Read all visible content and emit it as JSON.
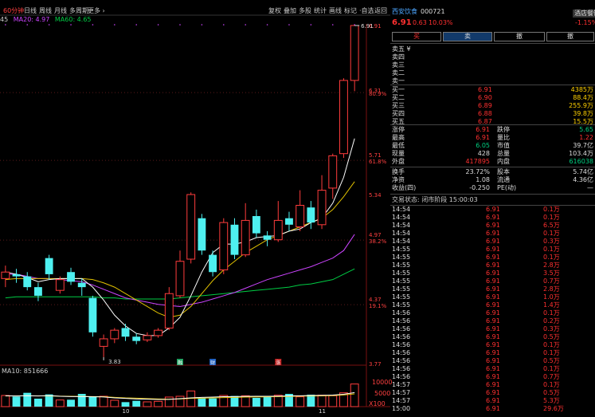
{
  "toolbar": {
    "period": "60分钟",
    "items": [
      "日线",
      "周线",
      "月线",
      "多周期",
      "更多 ›"
    ],
    "right_items": [
      "复权",
      "叠加",
      "多股",
      "统计",
      "画线",
      "标记",
      "·自选",
      "返回"
    ]
  },
  "ma_legend": {
    "prefix": "45",
    "ma20_label": "MA20: 4.97",
    "ma60_label": "MA60: 4.65",
    "ma20_color": "#cc44ff",
    "ma60_color": "#00cc44"
  },
  "price_axis": [
    {
      "label": "6.91",
      "price": 6.91
    },
    {
      "label": "6.31",
      "price": 6.31
    },
    {
      "label": "80.9%",
      "price": 6.28
    },
    {
      "label": "5.71",
      "price": 5.71
    },
    {
      "label": "61.8%",
      "price": 5.65
    },
    {
      "label": "5.34",
      "price": 5.34
    },
    {
      "label": "4.97",
      "price": 4.97
    },
    {
      "label": "38.2%",
      "price": 4.91
    },
    {
      "label": "4.37",
      "price": 4.37
    },
    {
      "label": "19.1%",
      "price": 4.31
    },
    {
      "label": "3.77",
      "price": 3.77
    }
  ],
  "chart_data": {
    "type": "candlestick",
    "annotations": {
      "high_label": "6.91",
      "low_label": "3.83"
    },
    "price_range": [
      3.77,
      6.91
    ],
    "x_tick_labels": [
      "10",
      "11"
    ],
    "event_markers": [
      "融",
      "财",
      "涨"
    ],
    "candles": [
      {
        "o": 4.56,
        "c": 4.62,
        "h": 4.68,
        "l": 4.48
      },
      {
        "o": 4.6,
        "c": 4.58,
        "h": 4.65,
        "l": 4.52
      },
      {
        "o": 4.58,
        "c": 4.48,
        "h": 4.62,
        "l": 4.45
      },
      {
        "o": 4.48,
        "c": 4.4,
        "h": 4.52,
        "l": 4.35
      },
      {
        "o": 4.75,
        "c": 4.6,
        "h": 4.78,
        "l": 4.55
      },
      {
        "o": 4.45,
        "c": 4.55,
        "h": 4.58,
        "l": 4.42
      },
      {
        "o": 4.62,
        "c": 4.53,
        "h": 4.66,
        "l": 4.5
      },
      {
        "o": 4.52,
        "c": 4.48,
        "h": 4.56,
        "l": 4.4
      },
      {
        "o": 4.38,
        "c": 4.06,
        "h": 4.4,
        "l": 4.02
      },
      {
        "o": 3.93,
        "c": 4.0,
        "h": 4.04,
        "l": 3.83
      },
      {
        "o": 4.0,
        "c": 4.08,
        "h": 4.1,
        "l": 3.96
      },
      {
        "o": 4.1,
        "c": 4.02,
        "h": 4.14,
        "l": 3.98
      },
      {
        "o": 4.02,
        "c": 3.98,
        "h": 4.05,
        "l": 3.95
      },
      {
        "o": 3.99,
        "c": 4.03,
        "h": 4.06,
        "l": 3.97
      },
      {
        "o": 4.03,
        "c": 4.08,
        "h": 4.1,
        "l": 4.01
      },
      {
        "o": 4.1,
        "c": 4.42,
        "h": 4.48,
        "l": 4.08
      },
      {
        "o": 4.4,
        "c": 4.72,
        "h": 4.82,
        "l": 4.38
      },
      {
        "o": 4.74,
        "c": 5.34,
        "h": 5.36,
        "l": 4.7
      },
      {
        "o": 5.12,
        "c": 4.82,
        "h": 5.16,
        "l": 4.78
      },
      {
        "o": 4.78,
        "c": 4.62,
        "h": 4.82,
        "l": 4.58
      },
      {
        "o": 4.64,
        "c": 5.08,
        "h": 5.12,
        "l": 4.6
      },
      {
        "o": 5.06,
        "c": 4.78,
        "h": 5.12,
        "l": 4.74
      },
      {
        "o": 4.78,
        "c": 5.1,
        "h": 5.26,
        "l": 4.76
      },
      {
        "o": 5.14,
        "c": 4.98,
        "h": 5.2,
        "l": 4.94
      },
      {
        "o": 4.96,
        "c": 4.92,
        "h": 5.0,
        "l": 4.86
      },
      {
        "o": 4.92,
        "c": 5.1,
        "h": 5.28,
        "l": 4.9
      },
      {
        "o": 5.12,
        "c": 5.06,
        "h": 5.18,
        "l": 5.0
      },
      {
        "o": 5.04,
        "c": 5.24,
        "h": 5.38,
        "l": 5.0
      },
      {
        "o": 5.22,
        "c": 5.08,
        "h": 5.28,
        "l": 5.02
      },
      {
        "o": 5.06,
        "c": 5.38,
        "h": 5.52,
        "l": 5.02
      },
      {
        "o": 5.4,
        "c": 5.7,
        "h": 5.72,
        "l": 5.3
      },
      {
        "o": 5.72,
        "c": 6.4,
        "h": 6.42,
        "l": 5.68
      },
      {
        "o": 6.4,
        "c": 6.91,
        "h": 6.91,
        "l": 6.3
      }
    ],
    "ma_white": [
      4.62,
      4.6,
      4.57,
      4.53,
      4.55,
      4.56,
      4.56,
      4.56,
      4.48,
      4.36,
      4.22,
      4.12,
      4.05,
      4.03,
      4.03,
      4.1,
      4.2,
      4.4,
      4.62,
      4.8,
      4.88,
      4.88,
      4.9,
      4.94,
      4.95,
      4.96,
      5.0,
      5.02,
      5.08,
      5.12,
      5.26,
      5.5,
      5.86
    ],
    "ma_yellow": [
      4.55,
      4.56,
      4.56,
      4.56,
      4.56,
      4.56,
      4.56,
      4.56,
      4.55,
      4.52,
      4.48,
      4.42,
      4.36,
      4.3,
      4.24,
      4.2,
      4.22,
      4.3,
      4.42,
      4.54,
      4.64,
      4.72,
      4.8,
      4.86,
      4.92,
      4.96,
      5.0,
      5.04,
      5.08,
      5.12,
      5.2,
      5.32,
      5.46
    ],
    "ma20": [
      4.6,
      4.6,
      4.58,
      4.56,
      4.56,
      4.55,
      4.54,
      4.53,
      4.5,
      4.46,
      4.42,
      4.38,
      4.36,
      4.34,
      4.32,
      4.31,
      4.3,
      4.32,
      4.34,
      4.37,
      4.4,
      4.43,
      4.47,
      4.51,
      4.55,
      4.58,
      4.61,
      4.64,
      4.67,
      4.71,
      4.75,
      4.82,
      4.97
    ],
    "ma60": [
      4.38,
      4.39,
      4.39,
      4.39,
      4.39,
      4.39,
      4.39,
      4.39,
      4.39,
      4.38,
      4.38,
      4.37,
      4.37,
      4.37,
      4.37,
      4.37,
      4.38,
      4.39,
      4.4,
      4.41,
      4.42,
      4.43,
      4.44,
      4.45,
      4.46,
      4.47,
      4.48,
      4.5,
      4.51,
      4.53,
      4.55,
      4.6,
      4.65
    ],
    "volume": [
      4200,
      3800,
      5200,
      3000,
      4600,
      2500,
      2600,
      4800,
      3600,
      3900,
      2400,
      1700,
      2200,
      1800,
      2000,
      3600,
      3900,
      5900,
      3300,
      3100,
      4200,
      4000,
      4100,
      3300,
      3600,
      4300,
      4800,
      3700,
      4500,
      4300,
      4100,
      5200,
      8516
    ],
    "volume_max": 12000,
    "vol_ma_yellow": [
      4000,
      4050,
      4100,
      4050,
      4000,
      3950,
      3900,
      3850,
      3800,
      3750,
      3500,
      3300,
      3200,
      3050,
      2900,
      2800,
      2900,
      3100,
      3200,
      3300,
      3400,
      3500,
      3600,
      3650,
      3700,
      3750,
      3850,
      3950,
      4000,
      4050,
      4150,
      4400,
      4800
    ],
    "vol_ma_white": [
      4100,
      4000,
      4100,
      4000,
      4150,
      3900,
      3800,
      3800,
      3700,
      3650,
      3300,
      3100,
      2900,
      2800,
      2700,
      2750,
      3000,
      3300,
      3500,
      3600,
      3750,
      3800,
      3850,
      3900,
      3900,
      3950,
      4050,
      4100,
      4200,
      4250,
      4350,
      4650,
      5300
    ]
  },
  "volume_panel": {
    "label": "MA10: 851666",
    "axis": [
      "10000",
      "5000",
      "X100"
    ]
  },
  "quote": {
    "name": "西安饮食",
    "code": "000721",
    "price": "6.91",
    "change": "0.63",
    "change_pct": "10.03%",
    "pct_badge": "-1.15%",
    "badge_top": "酒店餐饮",
    "buttons": [
      "买",
      "卖",
      "撤",
      "撤"
    ],
    "asks": [
      {
        "label": "卖五 ¥",
        "price": "",
        "vol": ""
      },
      {
        "label": "卖四",
        "price": "",
        "vol": ""
      },
      {
        "label": "卖三",
        "price": "",
        "vol": ""
      },
      {
        "label": "卖二",
        "price": "",
        "vol": ""
      },
      {
        "label": "卖一",
        "price": "",
        "vol": ""
      }
    ],
    "bids": [
      {
        "label": "买一",
        "price": "6.91",
        "vol": "4385万"
      },
      {
        "label": "买二",
        "price": "6.90",
        "vol": "88.4万"
      },
      {
        "label": "买三",
        "price": "6.89",
        "vol": "255.9万"
      },
      {
        "label": "买四",
        "price": "6.88",
        "vol": "39.8万"
      },
      {
        "label": "买五",
        "price": "6.87",
        "vol": "15.5万"
      }
    ],
    "stats": [
      {
        "l1": "涨停",
        "v1": "6.91",
        "c1": "r",
        "l2": "跌停",
        "v2": "5.65",
        "c2": "g"
      },
      {
        "l1": "最高",
        "v1": "6.91",
        "c1": "r",
        "l2": "量比",
        "v2": "1.22",
        "c2": "r"
      },
      {
        "l1": "最低",
        "v1": "6.05",
        "c1": "g",
        "l2": "市值",
        "v2": "39.7亿",
        "c2": "w"
      },
      {
        "l1": "现量",
        "v1": "428",
        "c1": "w",
        "l2": "总量",
        "v2": "103.4万",
        "c2": "w"
      },
      {
        "l1": "外盘",
        "v1": "417895",
        "c1": "r",
        "l2": "内盘",
        "v2": "616038",
        "c2": "g"
      }
    ],
    "stats2": [
      {
        "l1": "换手",
        "v1": "23.72%",
        "l2": "股本",
        "v2": "5.74亿"
      },
      {
        "l1": "净资",
        "v1": "1.08",
        "l2": "流通",
        "v2": "4.36亿"
      },
      {
        "l1": "收益(四)",
        "v1": "-0.250",
        "l2": "PE(动)",
        "v2": "—"
      }
    ],
    "status": "交易状态: 闭市阶段 15:00:03"
  },
  "ticks": [
    {
      "t": "14:54",
      "p": "6.91",
      "v": "0.1万",
      "c": "r"
    },
    {
      "t": "14:54",
      "p": "6.91",
      "v": "0.1万",
      "c": "r"
    },
    {
      "t": "14:54",
      "p": "6.91",
      "v": "6.5万",
      "c": "r"
    },
    {
      "t": "14:54",
      "p": "6.91",
      "v": "0.1万",
      "c": "r"
    },
    {
      "t": "14:54",
      "p": "6.91",
      "v": "0.3万",
      "c": "r"
    },
    {
      "t": "14:55",
      "p": "6.91",
      "v": "0.1万",
      "c": "r"
    },
    {
      "t": "14:55",
      "p": "6.91",
      "v": "0.1万",
      "c": "r"
    },
    {
      "t": "14:55",
      "p": "6.91",
      "v": "2.8万",
      "c": "r"
    },
    {
      "t": "14:55",
      "p": "6.91",
      "v": "3.5万",
      "c": "r"
    },
    {
      "t": "14:55",
      "p": "6.91",
      "v": "0.7万",
      "c": "r"
    },
    {
      "t": "14:55",
      "p": "6.91",
      "v": "2.8万",
      "c": "r"
    },
    {
      "t": "14:55",
      "p": "6.91",
      "v": "1.0万",
      "c": "r"
    },
    {
      "t": "14:55",
      "p": "6.91",
      "v": "1.4万",
      "c": "r"
    },
    {
      "t": "14:56",
      "p": "6.91",
      "v": "0.1万",
      "c": "r"
    },
    {
      "t": "14:56",
      "p": "6.91",
      "v": "0.2万",
      "c": "r"
    },
    {
      "t": "14:56",
      "p": "6.91",
      "v": "0.3万",
      "c": "r"
    },
    {
      "t": "14:56",
      "p": "6.91",
      "v": "0.5万",
      "c": "r"
    },
    {
      "t": "14:56",
      "p": "6.91",
      "v": "0.1万",
      "c": "r"
    },
    {
      "t": "14:56",
      "p": "6.91",
      "v": "0.1万",
      "c": "r"
    },
    {
      "t": "14:56",
      "p": "6.91",
      "v": "0.5万",
      "c": "r"
    },
    {
      "t": "14:56",
      "p": "6.91",
      "v": "0.1万",
      "c": "r"
    },
    {
      "t": "14:56",
      "p": "6.91",
      "v": "0.7万",
      "c": "r"
    },
    {
      "t": "14:57",
      "p": "6.91",
      "v": "0.1万",
      "c": "r"
    },
    {
      "t": "14:57",
      "p": "6.91",
      "v": "0.5万",
      "c": "r"
    },
    {
      "t": "14:57",
      "p": "6.91",
      "v": "5.3万",
      "c": "r"
    },
    {
      "t": "15:00",
      "p": "6.91",
      "v": "29.6万",
      "c": "r"
    }
  ]
}
